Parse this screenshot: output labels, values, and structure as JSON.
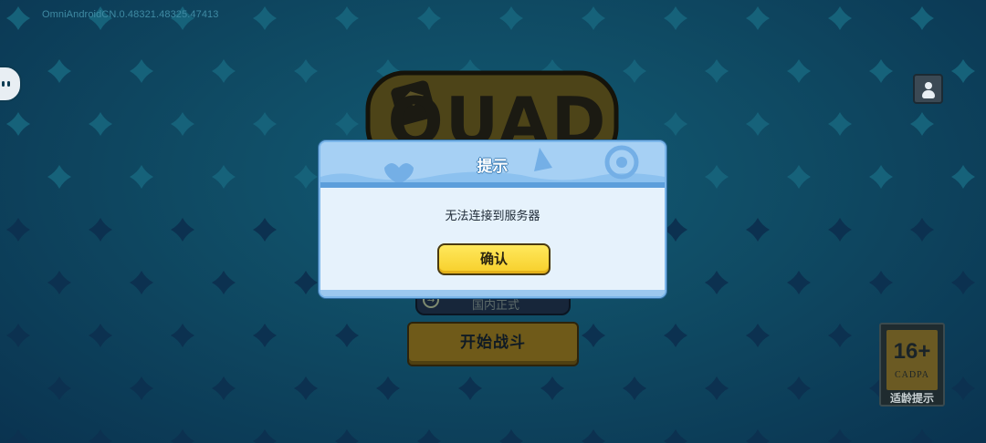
{
  "version_text": "OmniAndroidCN.0.48321.48325.47413",
  "logo_text": "QUAD",
  "dialog": {
    "title": "提示",
    "message": "无法连接到服务器",
    "confirm_label": "确认"
  },
  "mode_selector": {
    "label": "国内正式",
    "swap_glyph": "⇆"
  },
  "start_button_label": "开始战斗",
  "age_rating": {
    "age": "16+",
    "org": "CADPA",
    "caption": "适龄提示"
  },
  "icons": {
    "chat": "chat-bubble-icon",
    "profile": "user-profile-icon",
    "swap": "swap-icon"
  },
  "colors": {
    "background": "#0f4a63",
    "dialog_bg": "#e6f2fc",
    "dialog_header": "#8cc1ef",
    "confirm_button": "#f7cf2a",
    "start_button": "#6f5a19"
  }
}
